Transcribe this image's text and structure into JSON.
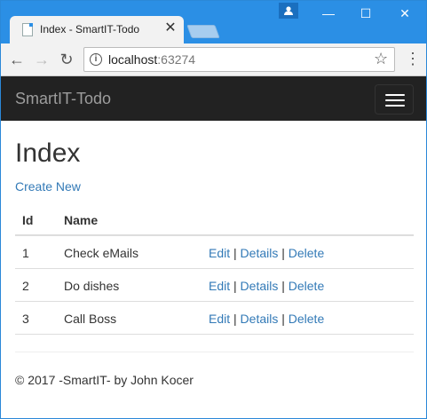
{
  "browser": {
    "tab_title": "Index - SmartIT-Todo",
    "url_host": "localhost",
    "url_port": ":63274"
  },
  "navbar": {
    "brand": "SmartIT-Todo"
  },
  "page": {
    "heading": "Index",
    "create_link": "Create New",
    "table": {
      "headers": [
        "Id",
        "Name"
      ],
      "rows": [
        {
          "id": "1",
          "name": "Check eMails",
          "edit": "Edit",
          "details": "Details",
          "delete": "Delete"
        },
        {
          "id": "2",
          "name": "Do dishes",
          "edit": "Edit",
          "details": "Details",
          "delete": "Delete"
        },
        {
          "id": "3",
          "name": "Call Boss",
          "edit": "Edit",
          "details": "Details",
          "delete": "Delete"
        }
      ],
      "separator": "|"
    },
    "footer": "© 2017 -SmartIT- by John Kocer"
  },
  "icons": {
    "tab_icon": "page-icon",
    "close": "close-icon",
    "back": "arrow-left-icon",
    "forward": "arrow-right-icon",
    "reload": "reload-icon",
    "info": "info-icon",
    "star": "star-icon",
    "menu": "kebab-menu-icon",
    "hamburger": "hamburger-icon"
  },
  "colors": {
    "titlebar": "#2b8fe5",
    "navbar": "#222222",
    "link": "#337ab7"
  }
}
